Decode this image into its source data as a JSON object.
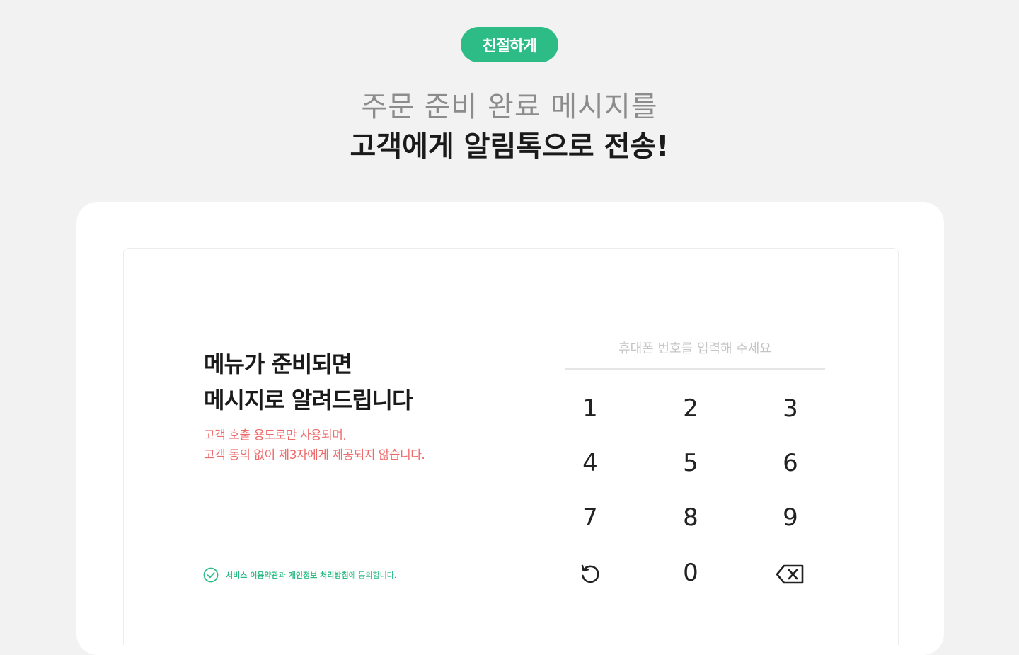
{
  "header": {
    "badge": "친절하게",
    "headline_line1": "주문 준비 완료 메시지를",
    "headline_line2": "고객에게 알림톡으로 전송!"
  },
  "form": {
    "title_line1": "메뉴가 준비되면",
    "title_line2": "메시지로 알려드립니다",
    "notice_line1": "고객 호출 용도로만 사용되며,",
    "notice_line2": "고객 동의 없이 제3자에게 제공되지 않습니다.",
    "agreement": {
      "terms_link": "서비스 이용약관",
      "connector1": "과",
      "privacy_link": "개인정보 처리방침",
      "connector2": "에 동의합니다."
    },
    "phone_placeholder": "휴대폰 번호를 입력해 주세요"
  },
  "keypad": {
    "keys": [
      "1",
      "2",
      "3",
      "4",
      "5",
      "6",
      "7",
      "8",
      "9",
      "0"
    ],
    "reset_icon": "refresh-icon",
    "backspace_icon": "backspace-icon"
  },
  "colors": {
    "accent": "#2dbb86",
    "notice": "#ee6b6b",
    "background": "#f2f2f2"
  }
}
